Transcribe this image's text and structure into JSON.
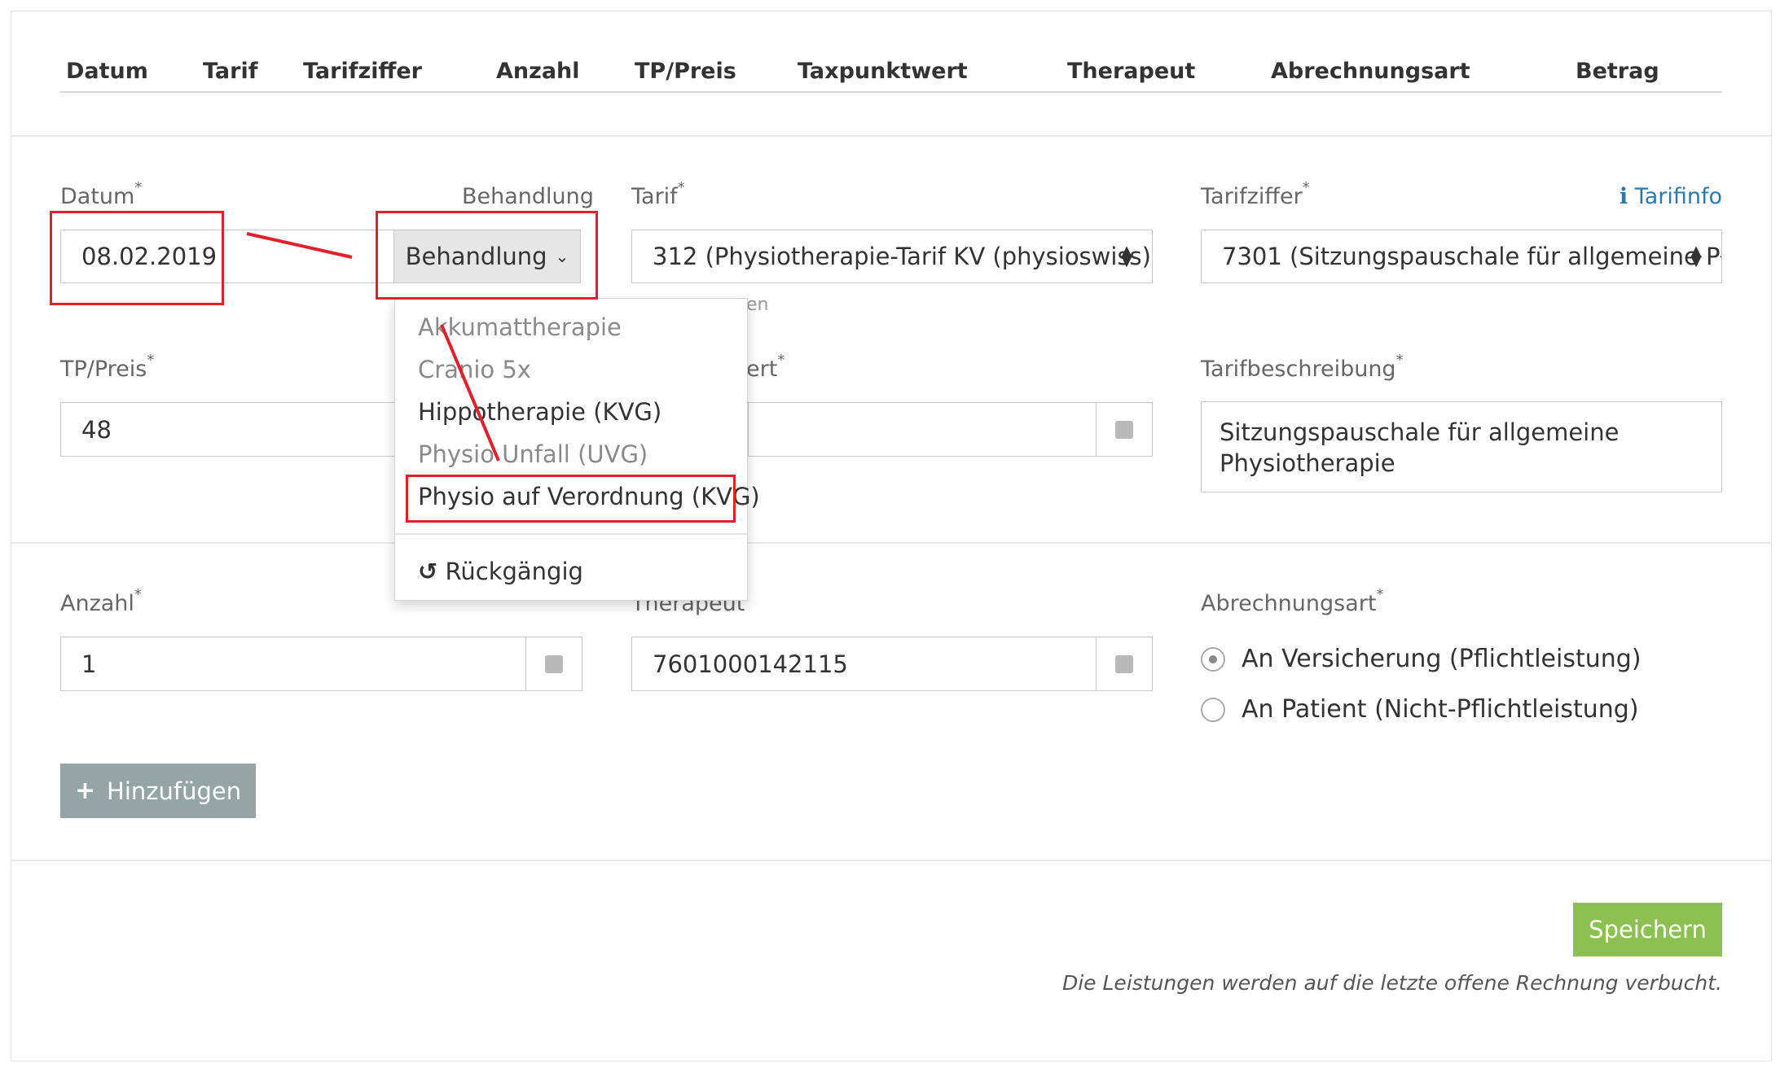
{
  "table_header": {
    "columns": [
      "Datum",
      "Tarif",
      "Tarifziffer",
      "Anzahl",
      "TP/Preis",
      "Taxpunktwert",
      "Therapeut",
      "Abrechnungsart",
      "Betrag"
    ]
  },
  "form": {
    "datum": {
      "label": "Datum",
      "value": "08.02.2019"
    },
    "behandlung": {
      "label": "Behandlung",
      "button_label": "Behandlung"
    },
    "tarif": {
      "label": "Tarif",
      "value": "312 (Physiotherapie-Tarif KV (physioswiss)"
    },
    "tarifziffer": {
      "label": "Tarifziffer",
      "value": "7301 (Sitzungspauschale für allgemeine Pł",
      "info_link": "Tarifinfo"
    },
    "tp_preis": {
      "label": "TP/Preis",
      "value": "48"
    },
    "taxpunktwert": {
      "label_partial": "ert",
      "hint_partial": "en"
    },
    "tarifbeschreibung": {
      "label": "Tarifbeschreibung",
      "value": "Sitzungspauschale für allgemeine Physiotherapie"
    },
    "anzahl": {
      "label": "Anzahl",
      "value": "1"
    },
    "therapeut": {
      "label": "Therapeut",
      "value": "7601000142115"
    },
    "abrechnungsart": {
      "label": "Abrechnungsart",
      "options": [
        "An Versicherung (Pflichtleistung)",
        "An Patient (Nicht-Pflichtleistung)"
      ],
      "selected": 0
    }
  },
  "dropdown": {
    "items": [
      {
        "label": "Akkumattherapie",
        "enabled": false
      },
      {
        "label": "Cranio 5x",
        "enabled": false
      },
      {
        "label": "Hippotherapie (KVG)",
        "enabled": true
      },
      {
        "label": "Physio Unfall (UVG)",
        "enabled": false
      },
      {
        "label": "Physio auf Verordnung (KVG)",
        "enabled": true
      }
    ],
    "undo_label": "Rückgängig"
  },
  "buttons": {
    "add": "Hinzufügen",
    "save": "Speichern"
  },
  "footer_note": "Die Leistungen werden auf die letzte offene Rechnung verbucht.",
  "annotation_color": "#e0202a"
}
